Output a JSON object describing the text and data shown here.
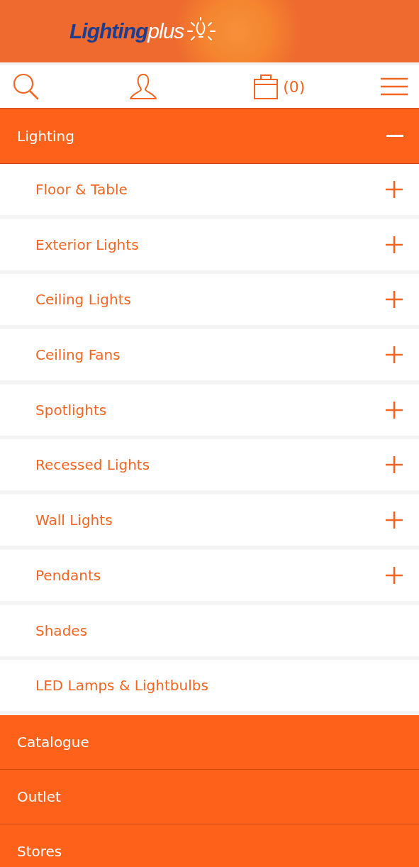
{
  "header": {
    "logo": "**Lighting**plus"
  },
  "toolbar": {
    "cart_count": "(0)"
  },
  "menu": [
    {
      "label": "Lighting",
      "expanded": true,
      "children": [
        {
          "label": "Floor & Table",
          "expandable": true
        },
        {
          "label": "Exterior Lights",
          "expandable": true
        },
        {
          "label": "Ceiling Lights",
          "expandable": true
        },
        {
          "label": "Ceiling Fans",
          "expandable": true
        },
        {
          "label": "Spotlights",
          "expandable": true
        },
        {
          "label": "Recessed Lights",
          "expandable": true
        },
        {
          "label": "Wall Lights",
          "expandable": true
        },
        {
          "label": "Pendants",
          "expandable": true
        },
        {
          "label": "Shades",
          "expandable": false
        },
        {
          "label": "LED Lamps & Lightbulbs",
          "expandable": false
        }
      ]
    },
    {
      "label": "Catalogue",
      "expanded": false
    },
    {
      "label": "Outlet",
      "expanded": false
    },
    {
      "label": "Stores",
      "expanded": false
    }
  ]
}
